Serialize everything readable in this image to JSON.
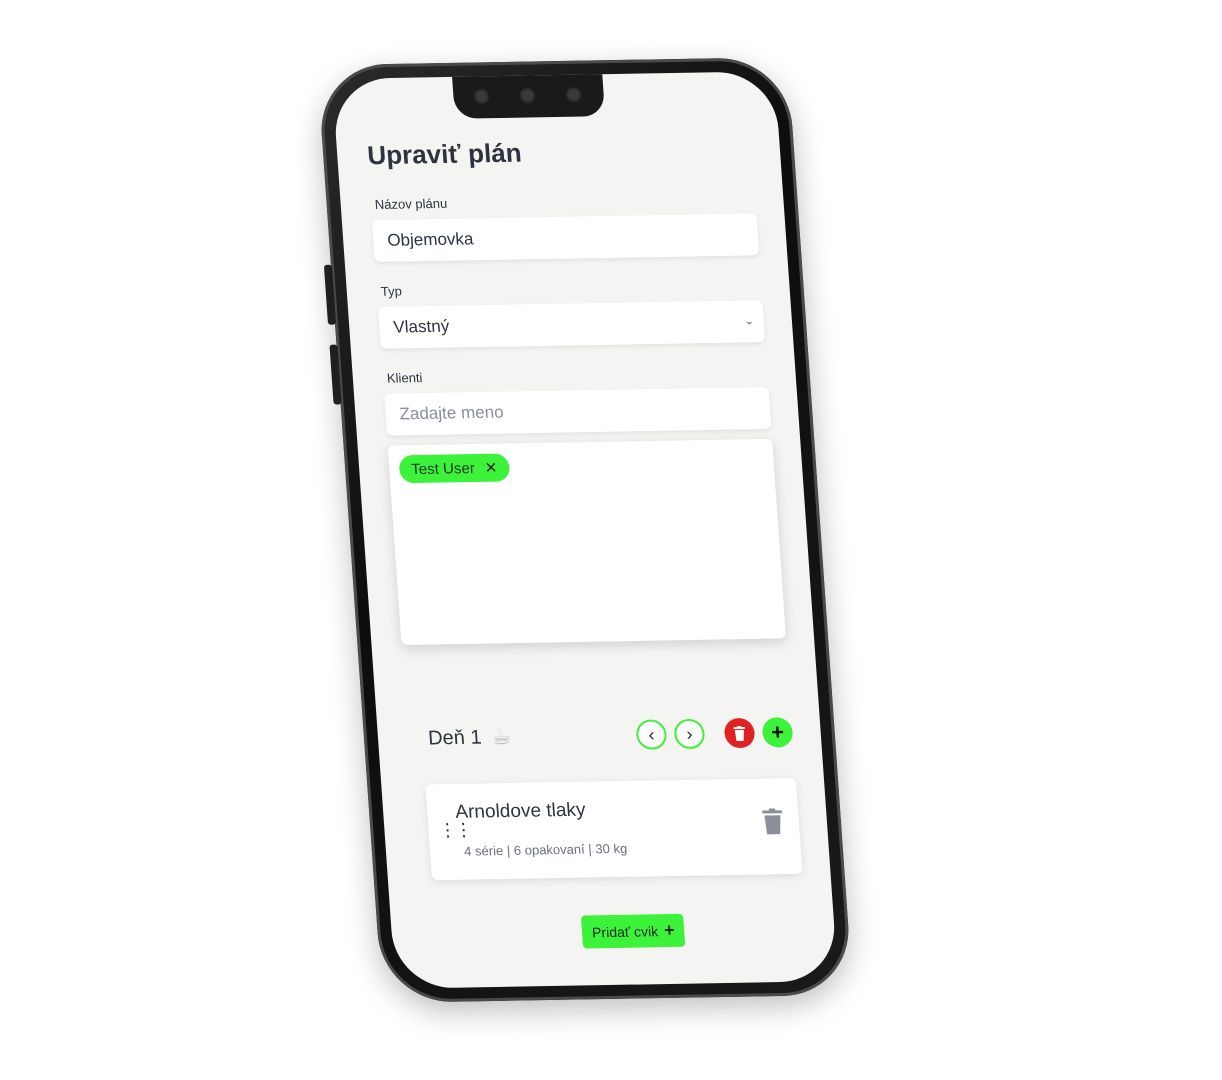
{
  "page": {
    "title": "Upraviť plán"
  },
  "form": {
    "name_label": "Názov plánu",
    "name_value": "Objemovka",
    "type_label": "Typ",
    "type_value": "Vlastný",
    "clients_label": "Klienti",
    "clients_placeholder": "Zadajte meno",
    "selected_clients": [
      "Test User"
    ]
  },
  "day": {
    "label": "Deň 1",
    "icons": {
      "rest": "coffee-cup-icon",
      "prev": "chevron-left-icon",
      "next": "chevron-right-icon",
      "delete": "trash-icon",
      "add": "plus-icon"
    }
  },
  "exercises": [
    {
      "name": "Arnoldove tlaky",
      "meta": "4 série | 6 opakovaní | 30 kg"
    }
  ],
  "actions": {
    "add_exercise": "Pridať cvik"
  },
  "colors": {
    "accent": "#3df23a",
    "danger": "#e02222",
    "text": "#2d3440",
    "screen_bg": "#f4f4f2"
  }
}
